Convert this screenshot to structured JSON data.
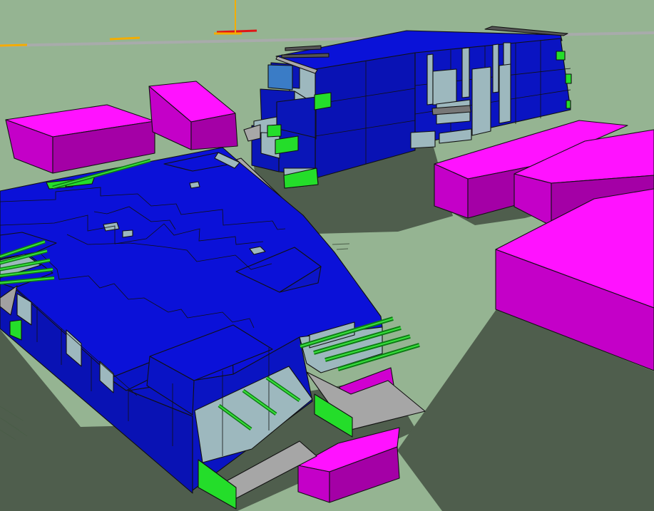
{
  "scene": {
    "background_color": "#95b492",
    "shadow_color": "#4f5e4d",
    "palette": {
      "roof_blue": "#0b11d8",
      "wall_blue": "#0a16b8",
      "glass": "#9db8be",
      "context_magenta_top": "#ff12ff",
      "context_magenta_side": "#c400c8",
      "context_magenta_dark": "#a400a6",
      "green_panel": "#24dd2a",
      "ground_gray": "#9b9d9d",
      "axis_red": "#e11515",
      "axis_yellow": "#f3ad00"
    }
  }
}
